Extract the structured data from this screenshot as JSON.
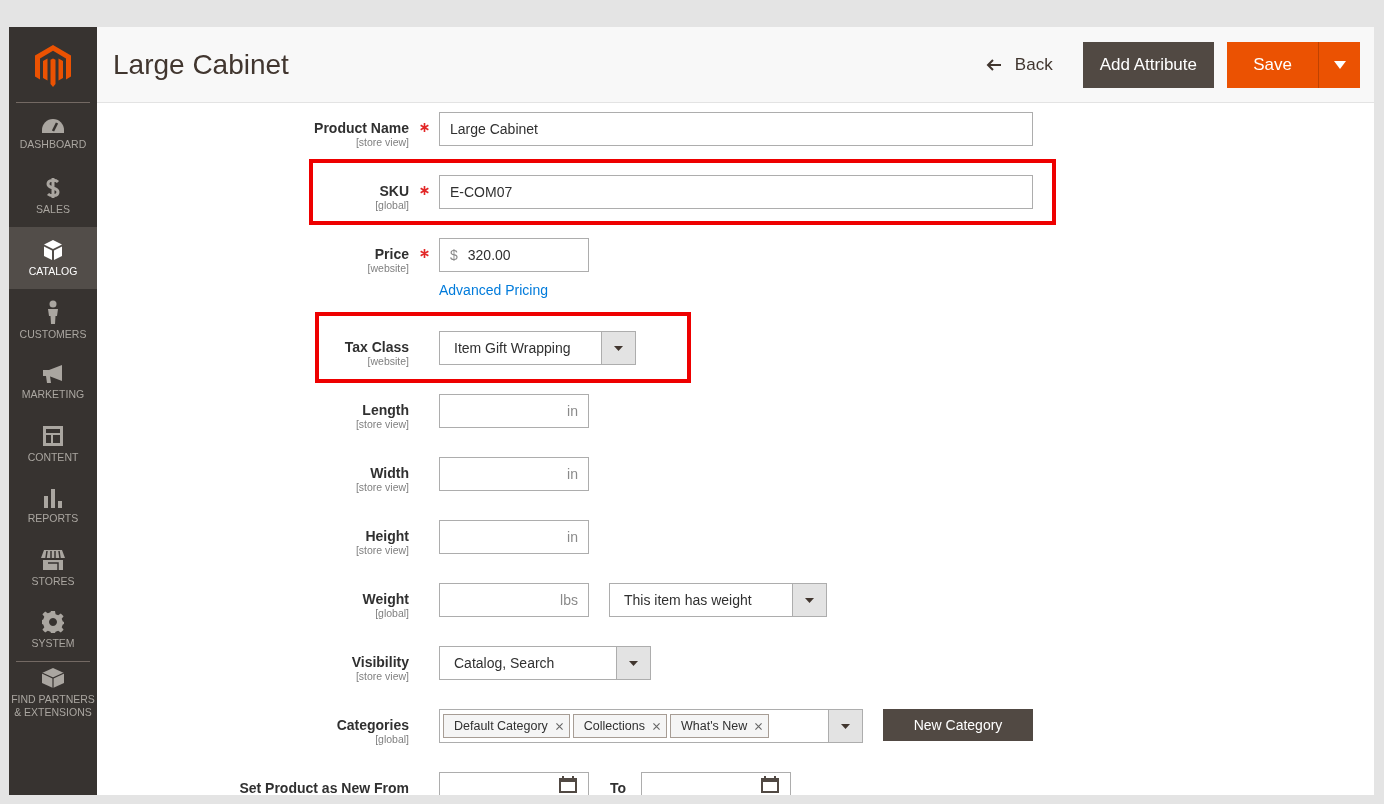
{
  "sidebar": {
    "items": [
      {
        "label": "DASHBOARD",
        "selected": false
      },
      {
        "label": "SALES",
        "selected": false
      },
      {
        "label": "CATALOG",
        "selected": true
      },
      {
        "label": "CUSTOMERS",
        "selected": false
      },
      {
        "label": "MARKETING",
        "selected": false
      },
      {
        "label": "CONTENT",
        "selected": false
      },
      {
        "label": "REPORTS",
        "selected": false
      },
      {
        "label": "STORES",
        "selected": false
      },
      {
        "label": "SYSTEM",
        "selected": false
      },
      {
        "label": "FIND PARTNERS & EXTENSIONS",
        "selected": false
      }
    ]
  },
  "header": {
    "title": "Large Cabinet",
    "back": "Back",
    "add_attribute": "Add Attribute",
    "save": "Save"
  },
  "fields": [
    {
      "kind": "text",
      "label": "Product Name",
      "scope": "[store view]",
      "required": true,
      "highlighted": false,
      "value": "Large Cabinet"
    },
    {
      "kind": "text",
      "label": "SKU",
      "scope": "[global]",
      "required": true,
      "highlighted": true,
      "value": "E-COM07"
    },
    {
      "kind": "price",
      "label": "Price",
      "scope": "[website]",
      "required": true,
      "highlighted": false,
      "prefix": "$",
      "value": "320.00",
      "link": "Advanced Pricing"
    },
    {
      "kind": "select",
      "label": "Tax Class",
      "scope": "[website]",
      "required": false,
      "highlighted": true,
      "value": "Item Gift Wrapping"
    },
    {
      "kind": "unit",
      "label": "Length",
      "scope": "[store view]",
      "required": false,
      "highlighted": false,
      "unit": "in"
    },
    {
      "kind": "unit",
      "label": "Width",
      "scope": "[store view]",
      "required": false,
      "highlighted": false,
      "unit": "in"
    },
    {
      "kind": "unit",
      "label": "Height",
      "scope": "[store view]",
      "required": false,
      "highlighted": false,
      "unit": "in"
    },
    {
      "kind": "weight",
      "label": "Weight",
      "scope": "[global]",
      "required": false,
      "highlighted": false,
      "unit": "lbs",
      "select": "This item has weight"
    },
    {
      "kind": "select",
      "label": "Visibility",
      "scope": "[store view]",
      "required": false,
      "highlighted": false,
      "value": "Catalog, Search"
    },
    {
      "kind": "tags",
      "label": "Categories",
      "scope": "[global]",
      "required": false,
      "highlighted": false,
      "tags": [
        "Default Category",
        "Collections",
        "What's New"
      ],
      "button": "New Category"
    },
    {
      "kind": "dates",
      "label": "Set Product as New From",
      "required": false,
      "highlighted": false,
      "to_label": "To"
    }
  ]
}
